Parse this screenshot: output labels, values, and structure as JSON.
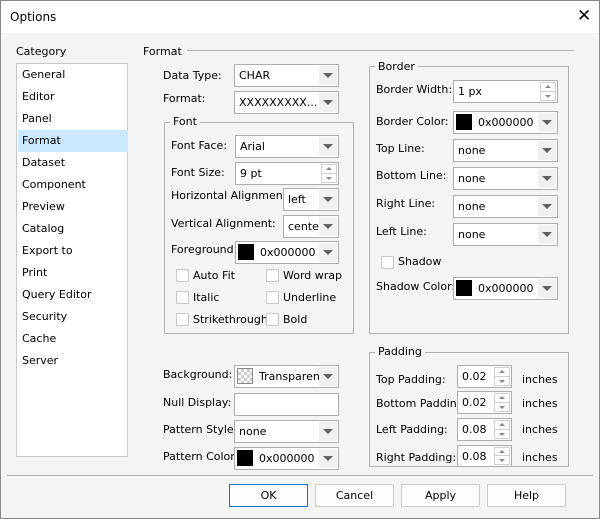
{
  "window": {
    "title": "Options"
  },
  "category": {
    "label": "Category",
    "items": [
      "General",
      "Editor",
      "Panel",
      "Format",
      "Dataset",
      "Component",
      "Preview",
      "Catalog",
      "Export to",
      "Print",
      "Query Editor",
      "Security",
      "Cache",
      "Server"
    ],
    "selected": "Format"
  },
  "format": {
    "group": "Format",
    "data_type_label": "Data Type:",
    "data_type": "CHAR",
    "format_label": "Format:",
    "format": "XXXXXXXXX..."
  },
  "font": {
    "group": "Font",
    "face_label": "Font Face:",
    "face": "Arial",
    "size_label": "Font Size:",
    "size": "9 pt",
    "halign_label": "Horizontal Alignment:",
    "halign": "left",
    "valign_label": "Vertical Alignment:",
    "valign": "center",
    "fg_label": "Foreground:",
    "fg": "0x000000",
    "checkboxes": [
      {
        "label": "Auto Fit",
        "checked": false
      },
      {
        "label": "Word wrap",
        "checked": false
      },
      {
        "label": "Italic",
        "checked": false
      },
      {
        "label": "Underline",
        "checked": false
      },
      {
        "label": "Strikethrough",
        "checked": false
      },
      {
        "label": "Bold",
        "checked": false
      }
    ]
  },
  "border": {
    "group": "Border",
    "width_label": "Border Width:",
    "width": "1 px",
    "color_label": "Border Color:",
    "color": "0x000000",
    "top_label": "Top Line:",
    "top": "none",
    "bottom_label": "Bottom Line:",
    "bottom": "none",
    "right_label": "Right Line:",
    "right": "none",
    "left_label": "Left Line:",
    "left": "none",
    "shadow_label": "Shadow",
    "shadow_checked": false,
    "shadow_color_label": "Shadow Color:",
    "shadow_color": "0x000000"
  },
  "misc": {
    "bg_label": "Background:",
    "bg": "Transparent",
    "null_label": "Null Display:",
    "null_value": "",
    "pattern_style_label": "Pattern Style:",
    "pattern_style": "none",
    "pattern_color_label": "Pattern Color:",
    "pattern_color": "0x000000"
  },
  "padding": {
    "group": "Padding",
    "unit": "inches",
    "top_label": "Top Padding:",
    "top": "0.02",
    "bottom_label": "Bottom Padding:",
    "bottom": "0.02",
    "left_label": "Left Padding:",
    "left": "0.08",
    "right_label": "Right Padding:",
    "right": "0.08"
  },
  "buttons": {
    "ok": "OK",
    "cancel": "Cancel",
    "apply": "Apply",
    "help": "Help"
  },
  "colors": {
    "selection": "#cce8ff",
    "default_button_border": "#0078d7"
  }
}
